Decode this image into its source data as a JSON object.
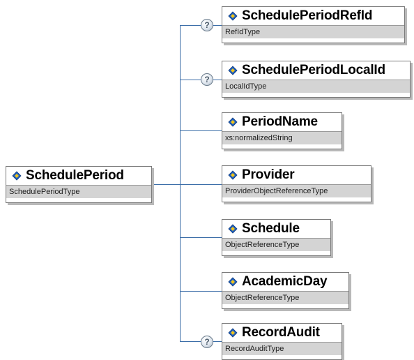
{
  "root": {
    "name": "SchedulePeriod",
    "type": "SchedulePeriodType"
  },
  "children": [
    {
      "name": "SchedulePeriodRefId",
      "type": "RefIdType",
      "optional": true
    },
    {
      "name": "SchedulePeriodLocalId",
      "type": "LocalIdType",
      "optional": true
    },
    {
      "name": "PeriodName",
      "type": "xs:normalizedString",
      "optional": false
    },
    {
      "name": "Provider",
      "type": "ProviderObjectReferenceType",
      "optional": false
    },
    {
      "name": "Schedule",
      "type": "ObjectReferenceType",
      "optional": false
    },
    {
      "name": "AcademicDay",
      "type": "ObjectReferenceType",
      "optional": false
    },
    {
      "name": "RecordAudit",
      "type": "RecordAuditType",
      "optional": true
    }
  ],
  "icons": {
    "element": "element-icon",
    "optional": "optional-question-icon"
  },
  "colors": {
    "connector": "#3c6ea8",
    "icon_blue": "#1f5fbf",
    "icon_yellow": "#f0c419",
    "type_bar": "#d4d4d4"
  },
  "optional_glyph": "?"
}
